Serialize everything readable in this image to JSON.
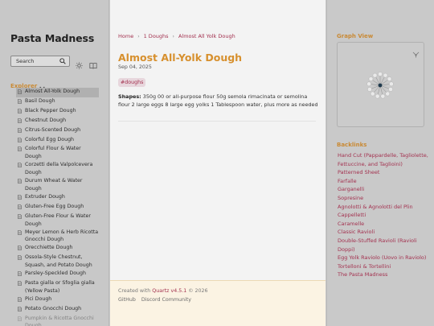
{
  "site": {
    "title": "Pasta Madness",
    "search_label": "Search",
    "explorer_label": "Explorer"
  },
  "sidebar": {
    "items": [
      {
        "label": "Almost All-Yolk Dough",
        "active": true
      },
      {
        "label": "Basil Dough"
      },
      {
        "label": "Black Pepper Dough"
      },
      {
        "label": "Chestnut Dough"
      },
      {
        "label": "Citrus-Scented Dough"
      },
      {
        "label": "Colorful Egg Dough"
      },
      {
        "label": "Colorful Flour & Water Dough"
      },
      {
        "label": "Corzetti della Valpolcevera Dough"
      },
      {
        "label": "Durum Wheat & Water Dough"
      },
      {
        "label": "Extruder Dough"
      },
      {
        "label": "Gluten-Free Egg Dough"
      },
      {
        "label": "Gluten-Free Flour & Water Dough"
      },
      {
        "label": "Meyer Lemon & Herb Ricotta Gnocchi Dough"
      },
      {
        "label": "Orecchiette Dough"
      },
      {
        "label": "Ossola-Style Chestnut, Squash, and Potato Dough"
      },
      {
        "label": "Parsley-Speckled Dough"
      },
      {
        "label": "Pasta gialla or Sfoglia gialla (Yellow Pasta)"
      },
      {
        "label": "Pici Dough"
      },
      {
        "label": "Potato Gnocchi Dough"
      },
      {
        "label": "Pumpkin & Ricotta Gnocchi Dough",
        "fade": true
      }
    ]
  },
  "breadcrumb": [
    "Home",
    "1 Doughs",
    "Almost All Yolk Dough"
  ],
  "page": {
    "title": "Almost All-Yolk Dough",
    "date": "Sep 04, 2025",
    "tag": "#doughs",
    "shapes_label": "Shapes:",
    "shapes_text": " 350g 00 or all-purpose flour 50g semola rimacinata or semolina flour 2 large eggs 8 large egg yolks 1 Tablespoon water, plus more as needed"
  },
  "footer": {
    "created_prefix": "Created with ",
    "quartz_link": "Quartz v4.5.1",
    "year": " © 2026",
    "links": [
      "GitHub",
      "Discord Community"
    ]
  },
  "graph": {
    "title": "Graph View",
    "node_count": 13,
    "colors": {
      "center": "#1f3a4d",
      "node": "#e9e9e9",
      "edge": "#8e8e8e"
    }
  },
  "backlinks": {
    "title": "Backlinks",
    "items": [
      "Hand Cut (Pappardelle, Tagliolette, Fettuccine, and Taglioini)",
      "Patterned Sheet",
      "Farfalle",
      "Garganelli",
      "Sopresine",
      "Agnolotti & Agnolotti del Plin",
      "Cappelletti",
      "Caramelle",
      "Classic Ravioli",
      "Double-Stuffed Ravioli (Ravioli Doppi)",
      "Egg Yolk Raviolo (Uovo in Raviolo)",
      "Tortelloni & Tortellini",
      "The Pasta Madness"
    ]
  },
  "colors": {
    "accent": "#a3314f",
    "heading": "#d7902e",
    "section": "#c98a35"
  }
}
